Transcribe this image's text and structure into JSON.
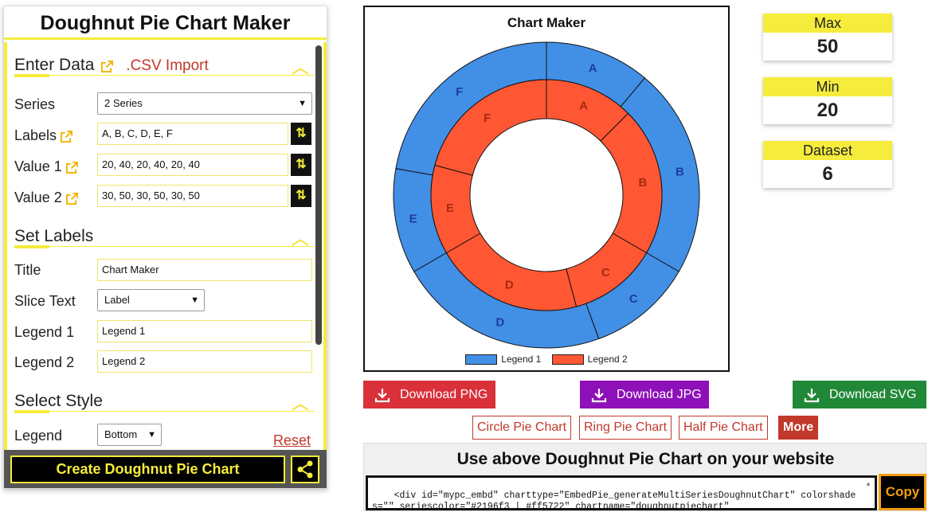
{
  "app": {
    "title": "Doughnut Pie Chart Maker"
  },
  "enter_data": {
    "heading": "Enter Data",
    "csv_import": ".CSV Import",
    "series_label": "Series",
    "series_value": "2 Series",
    "labels_label": "Labels",
    "labels_value": "A, B, C, D, E, F",
    "value1_label": "Value 1",
    "value1_value": "20, 40, 20, 40, 20, 40",
    "value2_label": "Value 2",
    "value2_value": "30, 50, 30, 50, 30, 50"
  },
  "set_labels": {
    "heading": "Set Labels",
    "title_label": "Title",
    "title_value": "Chart Maker",
    "slice_text_label": "Slice Text",
    "slice_text_value": "Label",
    "legend1_label": "Legend 1",
    "legend1_value": "Legend 1",
    "legend2_label": "Legend 2",
    "legend2_value": "Legend 2"
  },
  "select_style": {
    "heading": "Select Style",
    "legend_label": "Legend",
    "legend_value": "Bottom",
    "reset": "Reset"
  },
  "create_button": "Create Doughnut Pie Chart",
  "stats": {
    "max_label": "Max",
    "max_value": "50",
    "min_label": "Min",
    "min_value": "20",
    "dataset_label": "Dataset",
    "dataset_value": "6"
  },
  "downloads": {
    "png": "Download PNG",
    "png_color": "#d9303a",
    "jpg": "Download JPG",
    "jpg_color": "#8e10b8",
    "svg": "Download SVG",
    "svg_color": "#218838"
  },
  "chart_types": {
    "circle": "Circle Pie Chart",
    "ring": "Ring Pie Chart",
    "half": "Half Pie Chart",
    "more": "More"
  },
  "embed": {
    "title": "Use above Doughnut Pie Chart on your website",
    "code": "<div id=\"mypc_embd\" charttype=\"EmbedPie_generateMultiSeriesDoughnutChart\" colorshades=\"\" seriescolor=\"#2196f3 | #ff5722\" chartname=\"doughnutpiechart\"",
    "copy": "Copy"
  },
  "chart_data": {
    "type": "doughnut",
    "title": "Chart Maker",
    "categories": [
      "A",
      "B",
      "C",
      "D",
      "E",
      "F"
    ],
    "series": [
      {
        "name": "Legend 1",
        "values": [
          20,
          40,
          20,
          40,
          20,
          40
        ],
        "color": "#428fe6"
      },
      {
        "name": "Legend 2",
        "values": [
          30,
          50,
          30,
          50,
          30,
          50
        ],
        "color": "#ff5733"
      }
    ],
    "legend_position": "bottom"
  }
}
